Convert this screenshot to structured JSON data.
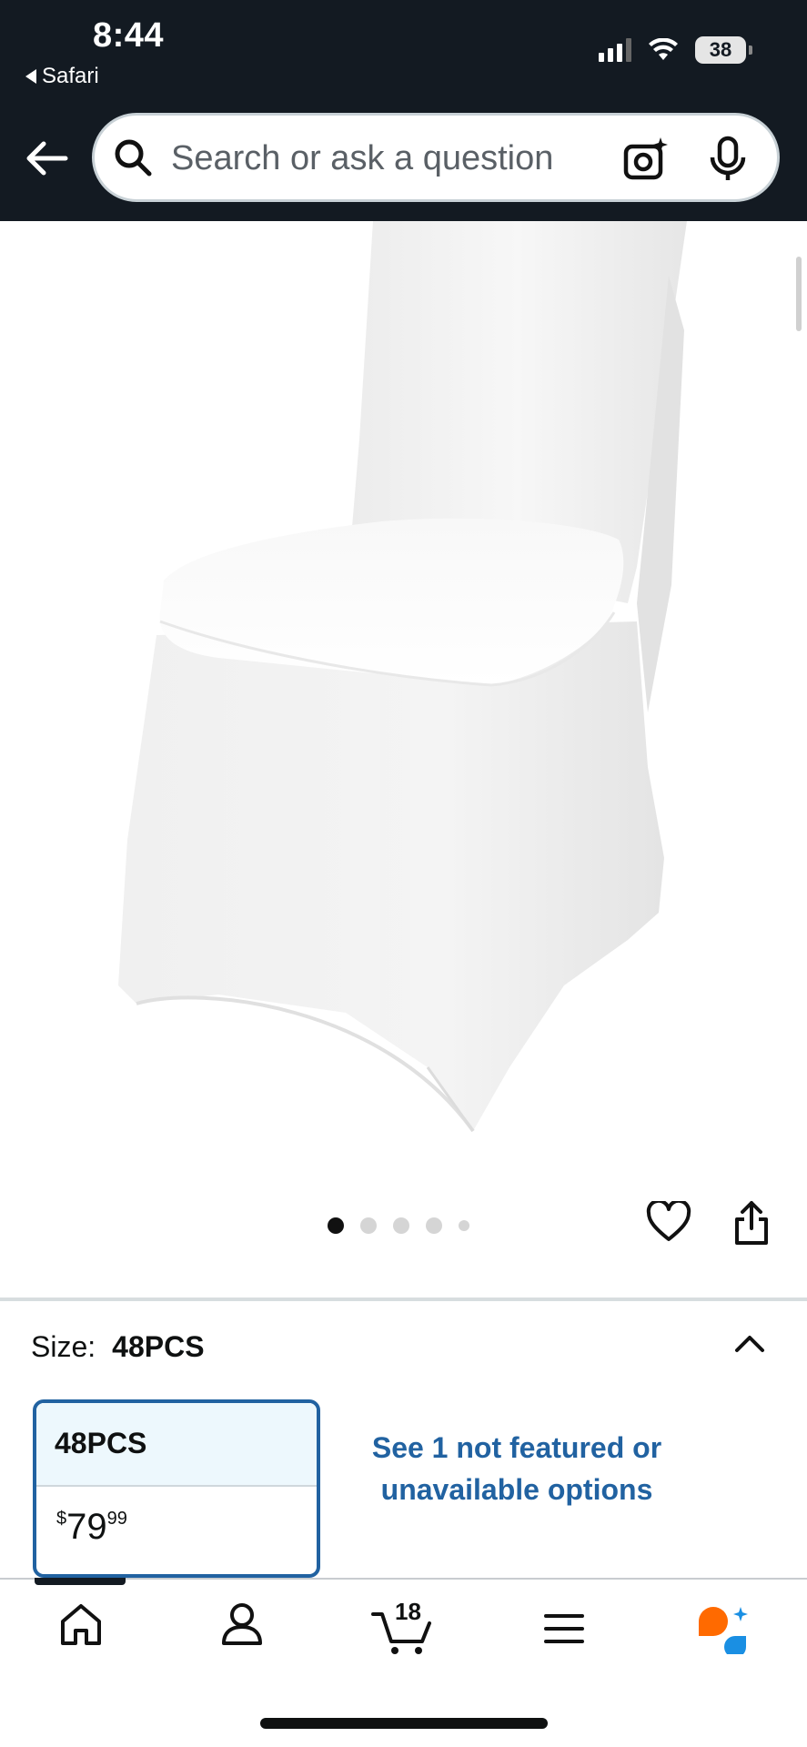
{
  "status_bar": {
    "time": "8:44",
    "back_app": "Safari",
    "battery": "38"
  },
  "search": {
    "placeholder": "Search or ask a question"
  },
  "gallery": {
    "image_count": 5,
    "active_index": 0
  },
  "size": {
    "label": "Size:",
    "selected": "48PCS"
  },
  "option": {
    "name": "48PCS",
    "currency": "$",
    "price_whole": "79",
    "price_cents": "99"
  },
  "see_more": "See 1 not featured or unavailable options",
  "bottom_nav": {
    "cart_count": "18",
    "items": [
      "home-icon",
      "account-icon",
      "cart-icon",
      "menu-icon",
      "rufus-icon"
    ]
  },
  "colors": {
    "header_bg": "#131a22",
    "link_blue": "#2162a1",
    "selected_bg": "#edf8fd",
    "rufus_orange": "#ff6a00",
    "rufus_blue": "#1a8fe3"
  }
}
